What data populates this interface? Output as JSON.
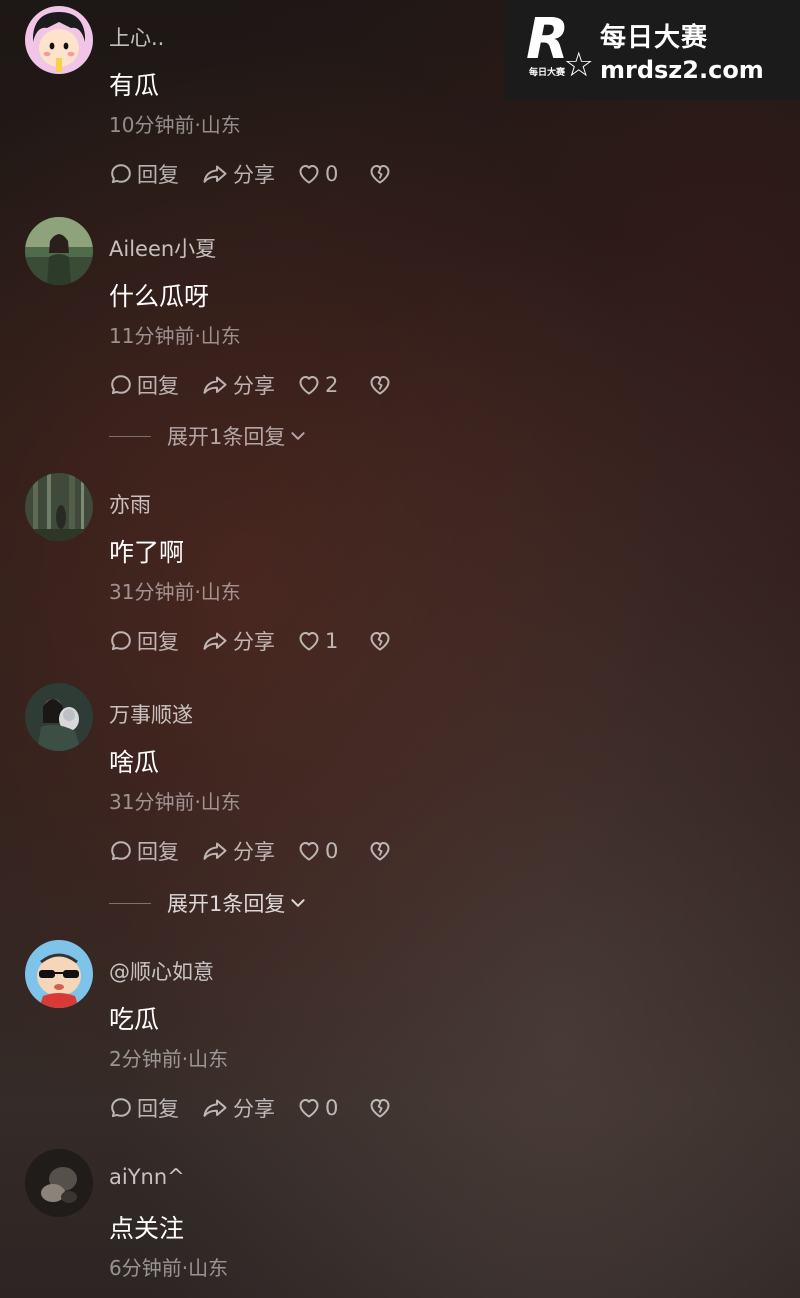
{
  "watermark": {
    "logo_letter": "R",
    "logo_small": "每日大赛",
    "title": "每日大赛",
    "url": "mrdsz2.com"
  },
  "actions": {
    "reply_label": "回复",
    "share_label": "分享"
  },
  "comments": [
    {
      "username": "上心..",
      "text": "有瓜",
      "time_location": "10分钟前·山东",
      "likes": "0",
      "avatar": "cartoon-girl-avatar"
    },
    {
      "username": "Aileen小夏",
      "text": "什么瓜呀",
      "time_location": "11分钟前·山东",
      "likes": "2",
      "avatar": "photo-person-avatar",
      "expand_label": "展开1条回复"
    },
    {
      "username": "亦雨",
      "text": "咋了啊",
      "time_location": "31分钟前·山东",
      "likes": "1",
      "avatar": "forest-photo-avatar"
    },
    {
      "username": "万事顺遂",
      "text": "啥瓜",
      "time_location": "31分钟前·山东",
      "likes": "0",
      "avatar": "photo-person-avatar",
      "expand_label": "展开1条回复"
    },
    {
      "username": "@顺心如意",
      "text": "吃瓜",
      "time_location": "2分钟前·山东",
      "likes": "0",
      "avatar": "cartoon-boy-avatar"
    },
    {
      "username": "aiYnn^",
      "text": "点关注",
      "time_location": "6分钟前·山东",
      "avatar": "dark-photo-avatar"
    }
  ]
}
